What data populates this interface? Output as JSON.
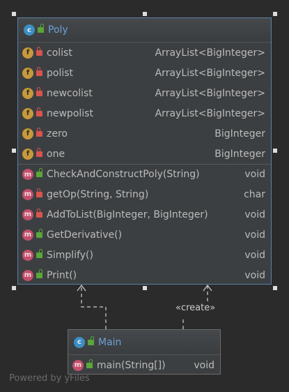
{
  "poly_class": {
    "kind_badge": "c",
    "name": "Poly",
    "fields": [
      {
        "badge": "f",
        "visibility": "private",
        "name": "colist",
        "type": "ArrayList<BigInteger>"
      },
      {
        "badge": "f",
        "visibility": "private",
        "name": "polist",
        "type": "ArrayList<BigInteger>"
      },
      {
        "badge": "f",
        "visibility": "private",
        "name": "newcolist",
        "type": "ArrayList<BigInteger>"
      },
      {
        "badge": "f",
        "visibility": "private",
        "name": "newpolist",
        "type": "ArrayList<BigInteger>"
      },
      {
        "badge": "f",
        "visibility": "private",
        "name": "zero",
        "type": "BigInteger"
      },
      {
        "badge": "f",
        "visibility": "private",
        "name": "one",
        "type": "BigInteger"
      }
    ],
    "methods": [
      {
        "badge": "m",
        "visibility": "public",
        "name": "CheckAndConstructPoly(String)",
        "type": "void"
      },
      {
        "badge": "m",
        "visibility": "private",
        "name": "getOp(String, String)",
        "type": "char"
      },
      {
        "badge": "m",
        "visibility": "private",
        "name": "AddToList(BigInteger, BigInteger)",
        "type": "void"
      },
      {
        "badge": "m",
        "visibility": "public",
        "name": "GetDerivative()",
        "type": "void"
      },
      {
        "badge": "m",
        "visibility": "public",
        "name": "Simplify()",
        "type": "void"
      },
      {
        "badge": "m",
        "visibility": "public",
        "name": "Print()",
        "type": "void"
      }
    ]
  },
  "main_class": {
    "kind_badge": "c",
    "name": "Main",
    "methods": [
      {
        "badge": "m",
        "visibility": "public",
        "name": "main(String[])",
        "type": "void"
      }
    ]
  },
  "relation_label": "«create»",
  "watermark_text": "Powered by yFiles",
  "colors": {
    "background": "#2b2b2b",
    "class_fill": "#3c3f41",
    "selected_border": "#5c7fa8",
    "class_name": "#6fa0d8",
    "field_badge": "#c8993b",
    "method_badge": "#c24f6b",
    "class_badge": "#3d8fc2"
  }
}
